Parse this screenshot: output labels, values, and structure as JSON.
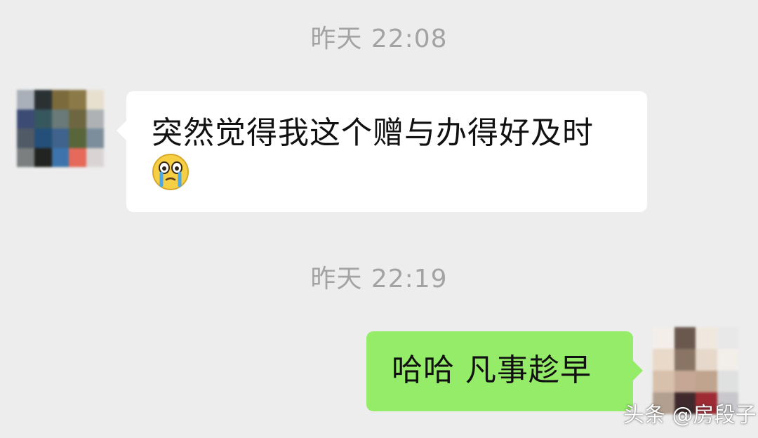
{
  "chat": {
    "timestamp_1": "昨天 22:08",
    "timestamp_2": "昨天 22:19",
    "message_in": {
      "text": "突然觉得我这个赠与办得好及时",
      "emoji": "crying-face-icon"
    },
    "message_out": {
      "text": "哈哈 凡事趁早"
    }
  },
  "watermark": {
    "text": "头条 @房段子"
  },
  "colors": {
    "background": "#ededed",
    "incoming_bubble": "#ffffff",
    "outgoing_bubble": "#95ec69",
    "timestamp": "#a3a3a3"
  }
}
